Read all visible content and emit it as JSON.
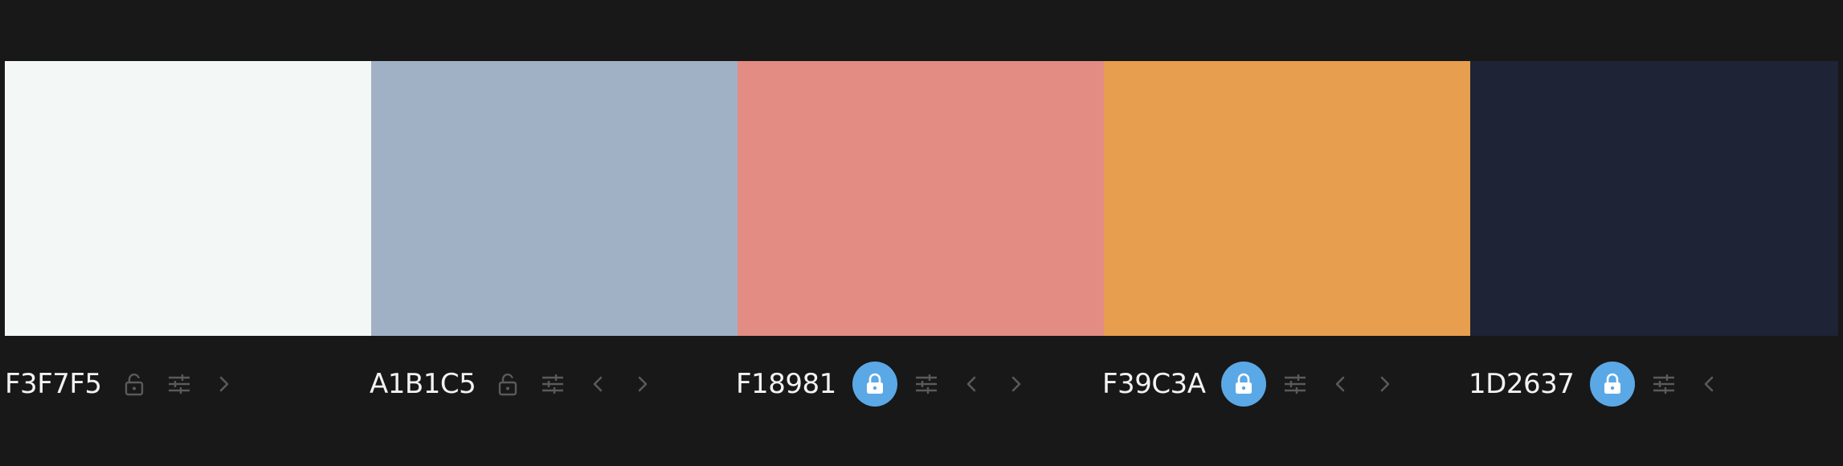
{
  "palette": {
    "swatches": [
      {
        "hex": "F3F7F5",
        "color": "#F3F7F5",
        "locked": false,
        "arrows": [
          "right"
        ]
      },
      {
        "hex": "A1B1C5",
        "color": "#A1B1C5",
        "locked": false,
        "arrows": [
          "left",
          "right"
        ]
      },
      {
        "hex": "F18981",
        "color": "#E38C84",
        "locked": true,
        "arrows": [
          "left",
          "right"
        ]
      },
      {
        "hex": "F39C3A",
        "color": "#E79E4E",
        "locked": true,
        "arrows": [
          "left",
          "right"
        ]
      },
      {
        "hex": "1D2637",
        "color": "#1E2435",
        "locked": true,
        "arrows": [
          "left"
        ]
      }
    ]
  },
  "colors": {
    "background": "#181818",
    "icon_muted": "#5a5a5a",
    "lock_active_bg": "#5BA8E6",
    "lock_active_icon": "#ffffff"
  },
  "icons": {
    "lock_open": "unlock-icon",
    "lock_closed": "lock-icon",
    "adjust": "sliders-icon",
    "left": "chevron-left-icon",
    "right": "chevron-right-icon"
  }
}
